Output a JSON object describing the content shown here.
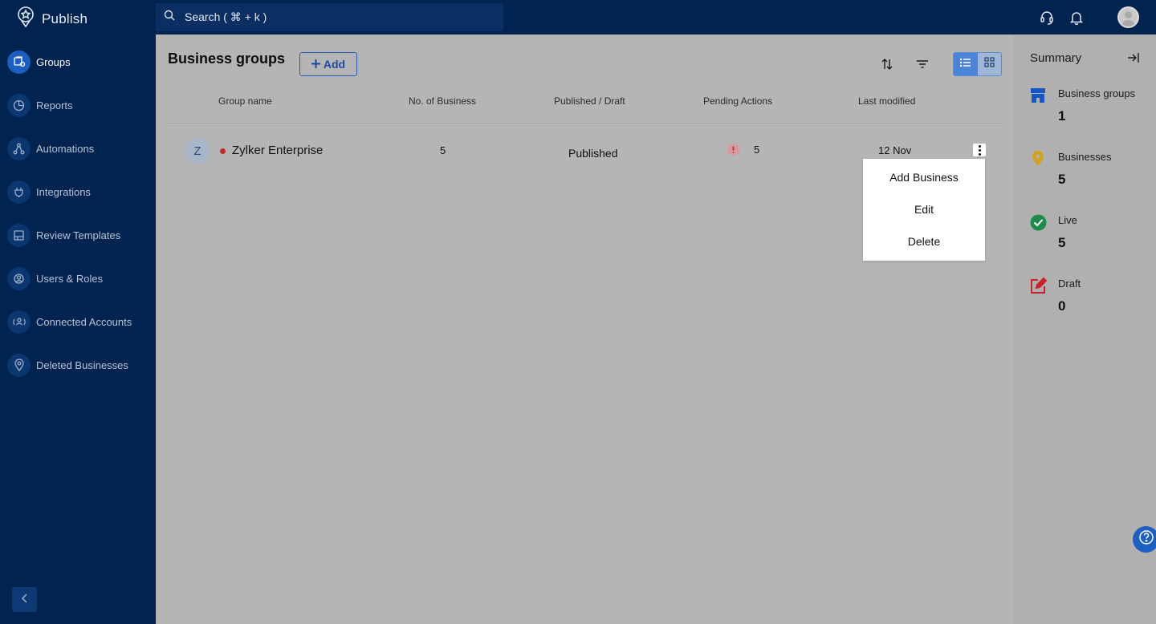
{
  "app": {
    "name": "Publish"
  },
  "search": {
    "placeholder": "Search ( ⌘ + k )"
  },
  "sidebar": {
    "items": [
      {
        "label": "Groups",
        "icon": "groups-icon",
        "active": true
      },
      {
        "label": "Reports",
        "icon": "reports-icon",
        "active": false
      },
      {
        "label": "Automations",
        "icon": "automations-icon",
        "active": false
      },
      {
        "label": "Integrations",
        "icon": "integrations-icon",
        "active": false
      },
      {
        "label": "Review Templates",
        "icon": "review-templates-icon",
        "active": false
      },
      {
        "label": "Users & Roles",
        "icon": "users-roles-icon",
        "active": false
      },
      {
        "label": "Connected Accounts",
        "icon": "connected-accounts-icon",
        "active": false
      },
      {
        "label": "Deleted Businesses",
        "icon": "deleted-businesses-icon",
        "active": false
      }
    ]
  },
  "main": {
    "title": "Business groups",
    "add_label": "Add",
    "columns": [
      "Group name",
      "No. of Business",
      "Published / Draft",
      "Pending Actions",
      "Last modified"
    ],
    "rows": [
      {
        "initial": "Z",
        "name": "Zylker Enterprise",
        "businesses": "5",
        "status": "Published",
        "pending": "5",
        "modified": "12 Nov"
      }
    ],
    "row_menu": [
      "Add Business",
      "Edit",
      "Delete"
    ]
  },
  "summary": {
    "title": "Summary",
    "stats": [
      {
        "label": "Business groups",
        "value": "1",
        "icon": "store-icon",
        "color": "#1a56c2"
      },
      {
        "label": "Businesses",
        "value": "5",
        "icon": "location-pin-icon",
        "color": "#d4a21a"
      },
      {
        "label": "Live",
        "value": "5",
        "icon": "check-circle-icon",
        "color": "#1f8a4a"
      },
      {
        "label": "Draft",
        "value": "0",
        "icon": "edit-square-icon",
        "color": "#c8232c"
      }
    ]
  },
  "colors": {
    "topbar": "#002350",
    "accent": "#1d5fc0",
    "overlay": "#b5b5b5"
  }
}
